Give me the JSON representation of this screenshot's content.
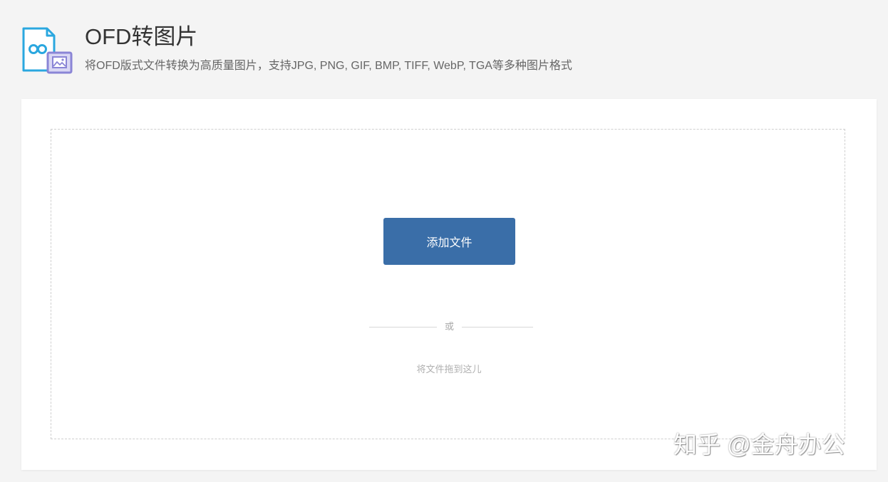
{
  "header": {
    "icon": "ofd-to-image-icon",
    "title": "OFD转图片",
    "subtitle": "将OFD版式文件转换为高质量图片，支持JPG, PNG, GIF, BMP, TIFF, WebP, TGA等多种图片格式"
  },
  "upload": {
    "add_button_label": "添加文件",
    "or_text": "或",
    "drop_hint": "将文件拖到这儿"
  },
  "watermark": {
    "text": "知乎 @金舟办公"
  },
  "colors": {
    "accent": "#3a6ea8",
    "icon_blue": "#2aa7df",
    "icon_purple": "#8a85d6",
    "background": "#f4f4f4"
  }
}
